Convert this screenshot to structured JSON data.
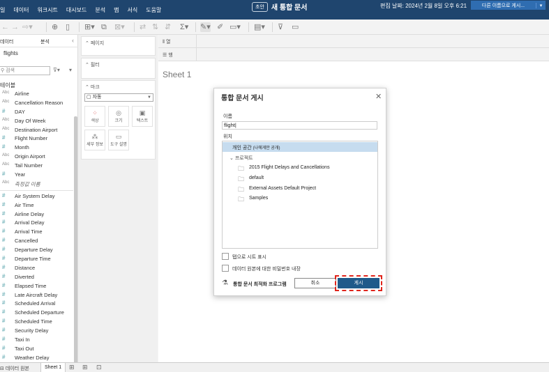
{
  "menu": [
    "일",
    "데이터",
    "워크시트",
    "대시보드",
    "분석",
    "맵",
    "서식",
    "도움말"
  ],
  "header": {
    "draft_badge": "초안",
    "doc_title": "새 통합 문서",
    "edit_date": "편집 날짜: 2024년 2월 8일 오후 6:21",
    "save_as_label": "다른 이름으로 게시..."
  },
  "left_pane": {
    "tab_data": "데이터",
    "tab_analysis": "분석",
    "datasource": "flights",
    "search_placeholder": "검색",
    "tables_header": "테이블",
    "dimensions": [
      {
        "type": "Abc",
        "name": "Airline"
      },
      {
        "type": "Abc",
        "name": "Cancellation Reason"
      },
      {
        "type": "#",
        "name": "DAY"
      },
      {
        "type": "Abc",
        "name": "Day Of Week"
      },
      {
        "type": "Abc",
        "name": "Destination Airport"
      },
      {
        "type": "#",
        "name": "Flight Number"
      },
      {
        "type": "#",
        "name": "Month"
      },
      {
        "type": "Abc",
        "name": "Origin Airport"
      },
      {
        "type": "Abc",
        "name": "Tail Number"
      },
      {
        "type": "#",
        "name": "Year"
      },
      {
        "type": "Abc",
        "name": "측정값 이름"
      }
    ],
    "measures": [
      "Air System Delay",
      "Air Time",
      "Airline Delay",
      "Arrival Delay",
      "Arrival Time",
      "Cancelled",
      "Departure Delay",
      "Departure Time",
      "Distance",
      "Diverted",
      "Elapsed Time",
      "Late Aircraft Delay",
      "Scheduled Arrival",
      "Scheduled Departure",
      "Scheduled Time",
      "Security Delay",
      "Taxi In",
      "Taxi Out",
      "Weather Delay"
    ]
  },
  "shelves": {
    "pages": "페이지",
    "filters": "필터",
    "marks": "마크",
    "marks_type": "자동",
    "mark_buttons": [
      "색상",
      "크기",
      "텍스트",
      "세부 정보",
      "도구 설명"
    ],
    "columns": "열",
    "rows": "행"
  },
  "canvas": {
    "sheet_title": "Sheet 1"
  },
  "statusbar": {
    "datasource": "데이터 원본",
    "sheet_tab": "Sheet 1"
  },
  "dialog": {
    "title": "통합 문서 게시",
    "name_label": "이름",
    "name_value": "flight",
    "location_label": "위치",
    "tree": {
      "personal": "개인 공간",
      "personal_note": "(나에게만 공개)",
      "projects": "프로젝트",
      "folders": [
        "2015 Flight Delays and Cancellations",
        "default",
        "External Assets Default Project",
        "Samples"
      ]
    },
    "show_tabs_label": "탭으로 시트 표시",
    "embed_password_label": "데이터 원본에 대한 비밀번호 내장",
    "optimizer_label": "통합 문서 최적화 프로그램",
    "cancel_label": "취소",
    "publish_label": "게시"
  },
  "colors": {
    "topbar": "#1f456e",
    "accent_button": "#2f6db1",
    "publish_button": "#1f5a8a",
    "highlight_outline": "#e0241b",
    "selection": "#c6dcef",
    "field_icon": "#4f9fa8"
  }
}
